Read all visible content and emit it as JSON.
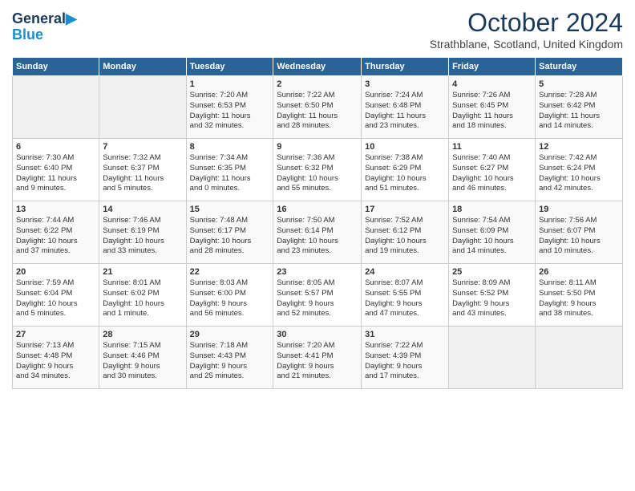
{
  "header": {
    "logo_line1": "General",
    "logo_line2": "Blue",
    "title": "October 2024",
    "subtitle": "Strathblane, Scotland, United Kingdom"
  },
  "weekdays": [
    "Sunday",
    "Monday",
    "Tuesday",
    "Wednesday",
    "Thursday",
    "Friday",
    "Saturday"
  ],
  "weeks": [
    [
      {
        "day": "",
        "info": ""
      },
      {
        "day": "",
        "info": ""
      },
      {
        "day": "1",
        "info": "Sunrise: 7:20 AM\nSunset: 6:53 PM\nDaylight: 11 hours\nand 32 minutes."
      },
      {
        "day": "2",
        "info": "Sunrise: 7:22 AM\nSunset: 6:50 PM\nDaylight: 11 hours\nand 28 minutes."
      },
      {
        "day": "3",
        "info": "Sunrise: 7:24 AM\nSunset: 6:48 PM\nDaylight: 11 hours\nand 23 minutes."
      },
      {
        "day": "4",
        "info": "Sunrise: 7:26 AM\nSunset: 6:45 PM\nDaylight: 11 hours\nand 18 minutes."
      },
      {
        "day": "5",
        "info": "Sunrise: 7:28 AM\nSunset: 6:42 PM\nDaylight: 11 hours\nand 14 minutes."
      }
    ],
    [
      {
        "day": "6",
        "info": "Sunrise: 7:30 AM\nSunset: 6:40 PM\nDaylight: 11 hours\nand 9 minutes."
      },
      {
        "day": "7",
        "info": "Sunrise: 7:32 AM\nSunset: 6:37 PM\nDaylight: 11 hours\nand 5 minutes."
      },
      {
        "day": "8",
        "info": "Sunrise: 7:34 AM\nSunset: 6:35 PM\nDaylight: 11 hours\nand 0 minutes."
      },
      {
        "day": "9",
        "info": "Sunrise: 7:36 AM\nSunset: 6:32 PM\nDaylight: 10 hours\nand 55 minutes."
      },
      {
        "day": "10",
        "info": "Sunrise: 7:38 AM\nSunset: 6:29 PM\nDaylight: 10 hours\nand 51 minutes."
      },
      {
        "day": "11",
        "info": "Sunrise: 7:40 AM\nSunset: 6:27 PM\nDaylight: 10 hours\nand 46 minutes."
      },
      {
        "day": "12",
        "info": "Sunrise: 7:42 AM\nSunset: 6:24 PM\nDaylight: 10 hours\nand 42 minutes."
      }
    ],
    [
      {
        "day": "13",
        "info": "Sunrise: 7:44 AM\nSunset: 6:22 PM\nDaylight: 10 hours\nand 37 minutes."
      },
      {
        "day": "14",
        "info": "Sunrise: 7:46 AM\nSunset: 6:19 PM\nDaylight: 10 hours\nand 33 minutes."
      },
      {
        "day": "15",
        "info": "Sunrise: 7:48 AM\nSunset: 6:17 PM\nDaylight: 10 hours\nand 28 minutes."
      },
      {
        "day": "16",
        "info": "Sunrise: 7:50 AM\nSunset: 6:14 PM\nDaylight: 10 hours\nand 23 minutes."
      },
      {
        "day": "17",
        "info": "Sunrise: 7:52 AM\nSunset: 6:12 PM\nDaylight: 10 hours\nand 19 minutes."
      },
      {
        "day": "18",
        "info": "Sunrise: 7:54 AM\nSunset: 6:09 PM\nDaylight: 10 hours\nand 14 minutes."
      },
      {
        "day": "19",
        "info": "Sunrise: 7:56 AM\nSunset: 6:07 PM\nDaylight: 10 hours\nand 10 minutes."
      }
    ],
    [
      {
        "day": "20",
        "info": "Sunrise: 7:59 AM\nSunset: 6:04 PM\nDaylight: 10 hours\nand 5 minutes."
      },
      {
        "day": "21",
        "info": "Sunrise: 8:01 AM\nSunset: 6:02 PM\nDaylight: 10 hours\nand 1 minute."
      },
      {
        "day": "22",
        "info": "Sunrise: 8:03 AM\nSunset: 6:00 PM\nDaylight: 9 hours\nand 56 minutes."
      },
      {
        "day": "23",
        "info": "Sunrise: 8:05 AM\nSunset: 5:57 PM\nDaylight: 9 hours\nand 52 minutes."
      },
      {
        "day": "24",
        "info": "Sunrise: 8:07 AM\nSunset: 5:55 PM\nDaylight: 9 hours\nand 47 minutes."
      },
      {
        "day": "25",
        "info": "Sunrise: 8:09 AM\nSunset: 5:52 PM\nDaylight: 9 hours\nand 43 minutes."
      },
      {
        "day": "26",
        "info": "Sunrise: 8:11 AM\nSunset: 5:50 PM\nDaylight: 9 hours\nand 38 minutes."
      }
    ],
    [
      {
        "day": "27",
        "info": "Sunrise: 7:13 AM\nSunset: 4:48 PM\nDaylight: 9 hours\nand 34 minutes."
      },
      {
        "day": "28",
        "info": "Sunrise: 7:15 AM\nSunset: 4:46 PM\nDaylight: 9 hours\nand 30 minutes."
      },
      {
        "day": "29",
        "info": "Sunrise: 7:18 AM\nSunset: 4:43 PM\nDaylight: 9 hours\nand 25 minutes."
      },
      {
        "day": "30",
        "info": "Sunrise: 7:20 AM\nSunset: 4:41 PM\nDaylight: 9 hours\nand 21 minutes."
      },
      {
        "day": "31",
        "info": "Sunrise: 7:22 AM\nSunset: 4:39 PM\nDaylight: 9 hours\nand 17 minutes."
      },
      {
        "day": "",
        "info": ""
      },
      {
        "day": "",
        "info": ""
      }
    ]
  ]
}
